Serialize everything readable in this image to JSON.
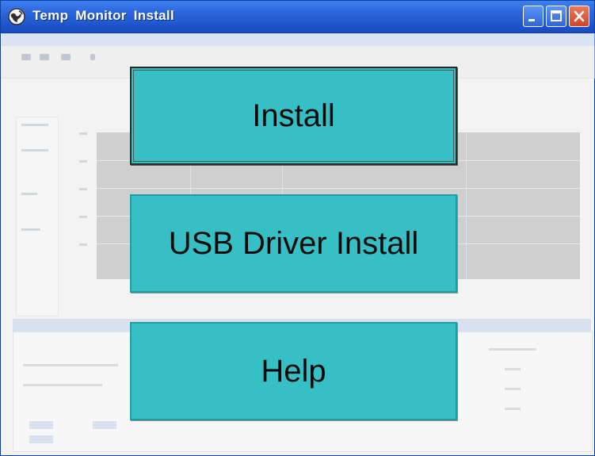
{
  "window": {
    "title": "Temp  Monitor  Install",
    "app_icon": "globe-icon",
    "controls": {
      "minimize": "minimize-icon",
      "maximize": "maximize-icon",
      "close": "close-icon"
    }
  },
  "buttons": {
    "install": "Install",
    "usb_driver_install": "USB Driver Install",
    "help": "Help"
  },
  "colors": {
    "titlebar": "#2b65d9",
    "button_face": "#36c0c5",
    "button_text": "#0a0a0a"
  }
}
